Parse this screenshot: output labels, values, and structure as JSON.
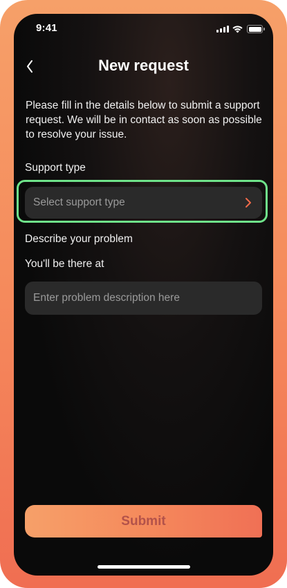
{
  "status_bar": {
    "time": "9:41",
    "icons": [
      "signal-icon",
      "wifi-icon",
      "battery-icon"
    ]
  },
  "header": {
    "back_icon": "chevron-left-icon",
    "title": "New request"
  },
  "intro_text": "Please fill in the details below to submit a support request. We will be in contact as soon as possible to resolve your issue.",
  "support_type": {
    "label": "Support type",
    "placeholder": "Select support type",
    "icon": "chevron-right-icon",
    "highlight_color": "#6fe38a",
    "chevron_color": "#f26b4a"
  },
  "problem": {
    "label": "Describe your problem",
    "secondary_label": "You'll be there at",
    "placeholder": "Enter problem description here"
  },
  "submit": {
    "label": "Submit"
  },
  "colors": {
    "frame_gradient_start": "#f6a069",
    "frame_gradient_end": "#f06e52",
    "field_background": "#2a2a2a",
    "submit_text": "#b3524a"
  }
}
